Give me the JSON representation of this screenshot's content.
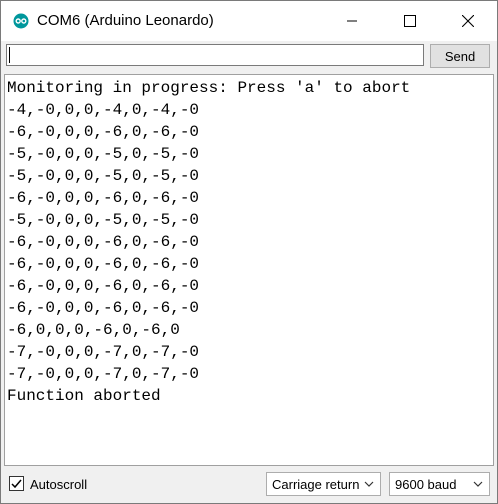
{
  "window": {
    "title": "COM6 (Arduino Leonardo)"
  },
  "toolbar": {
    "input_value": "",
    "send_label": "Send"
  },
  "output": {
    "lines": [
      "Monitoring in progress: Press 'a' to abort",
      "-4,-0,0,0,-4,0,-4,-0",
      "-6,-0,0,0,-6,0,-6,-0",
      "-5,-0,0,0,-5,0,-5,-0",
      "-5,-0,0,0,-5,0,-5,-0",
      "-6,-0,0,0,-6,0,-6,-0",
      "-5,-0,0,0,-5,0,-5,-0",
      "-6,-0,0,0,-6,0,-6,-0",
      "-6,-0,0,0,-6,0,-6,-0",
      "-6,-0,0,0,-6,0,-6,-0",
      "-6,-0,0,0,-6,0,-6,-0",
      "-6,0,0,0,-6,0,-6,0",
      "-7,-0,0,0,-7,0,-7,-0",
      "-7,-0,0,0,-7,0,-7,-0",
      "Function aborted"
    ]
  },
  "statusbar": {
    "autoscroll_label": "Autoscroll",
    "autoscroll_checked": true,
    "line_ending": "Carriage return",
    "baud": "9600 baud"
  },
  "colors": {
    "arduino_teal": "#00979c"
  }
}
